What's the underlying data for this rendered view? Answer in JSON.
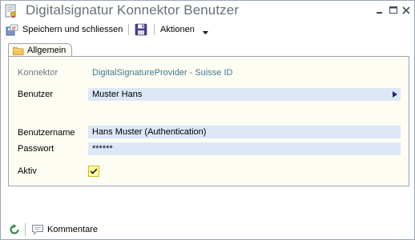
{
  "window": {
    "title": "Digitalsignatur Konnektor Benutzer",
    "icon": "document-seal-icon"
  },
  "toolbar": {
    "save_close_label": "Speichern und schliessen",
    "save_icon": "floppy-disk-icon",
    "actions_label": "Aktionen"
  },
  "tabs": [
    {
      "label": "Allgemein",
      "icon": "folder-icon",
      "active": true
    }
  ],
  "form": {
    "konnektor": {
      "label": "Konnektor",
      "value": "DigitalSignatureProvider - Suisse ID"
    },
    "benutzer": {
      "label": "Benutzer",
      "value": "Muster Hans"
    },
    "benutzername": {
      "label": "Benutzername",
      "value": "Hans Muster (Authentication)"
    },
    "passwort": {
      "label": "Passwort",
      "value": "******"
    },
    "aktiv": {
      "label": "Aktiv",
      "checked": true
    }
  },
  "bottom": {
    "refresh_icon": "refresh-icon",
    "comments_label": "Kommentare",
    "comments_icon": "speech-bubble-icon"
  },
  "colors": {
    "title_text": "#66707b",
    "panel_bg": "#fdfdf3",
    "field_bg": "#dde7f7",
    "link_text": "#3f7a8b",
    "checkbox_border": "#e0b400"
  }
}
